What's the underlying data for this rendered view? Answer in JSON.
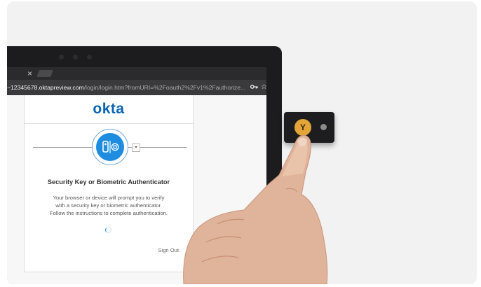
{
  "browser": {
    "tab_close_glyph": "×",
    "url_host": "~12345678.oktapreview.com",
    "url_path": "/login/login.htm?fromURI=%2Foauth2%2Fv1%2Fauthorize...",
    "key_icon": "key-icon",
    "star_icon": "star-icon"
  },
  "okta": {
    "logo": "okta",
    "dropdown_glyph": "▾",
    "title": "Security Key or Biometric Authenticator",
    "description_lines": [
      "Your browser or device will prompt you to verify",
      "with a security key or biometric authenticator.",
      "Follow the instructions to complete authentication."
    ],
    "sign_out": "Sign Out"
  },
  "security_key": {
    "button_glyph": "Y"
  },
  "colors": {
    "okta_blue": "#0a64b5",
    "factor_blue": "#1e8de0",
    "yubikey_gold": "#e3a537"
  }
}
